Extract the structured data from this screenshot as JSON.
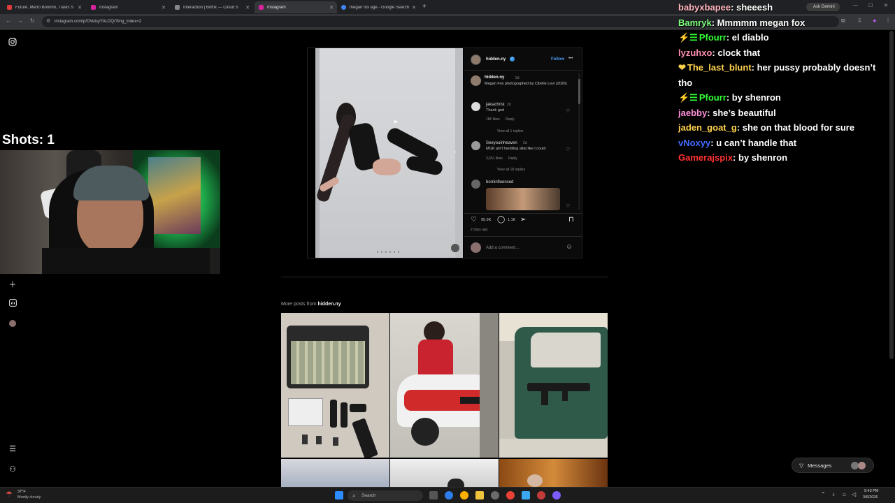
{
  "browser": {
    "tabs": [
      {
        "title": "Future, Metro Boomin, Travis S",
        "active": false,
        "color": "#e03b3b"
      },
      {
        "title": "Instagram",
        "active": false,
        "color": "#d6249f"
      },
      {
        "title": "Interaction | Botfix — Cloud S",
        "active": false,
        "color": "#888888"
      },
      {
        "title": "Instagram",
        "active": true,
        "color": "#d6249f"
      },
      {
        "title": "megan fox age - Google Search",
        "active": false,
        "color": "#4285f4"
      }
    ],
    "new_tab": "+",
    "url": "instagram.com/p/DVetsyYALDQ/?img_index=2",
    "ask_gemini": "Ask Gemini"
  },
  "stream": {
    "shots_label": "Shots: 1"
  },
  "post": {
    "username": "hidden.ny",
    "follow_label": "Follow",
    "more": "•••",
    "caption_user": "hidden.ny",
    "caption_age": "2d",
    "caption_text": "Megan Fox photographed by Cibelle Levi (2026)",
    "comments": [
      {
        "user": "jakiachrist",
        "age": "2d",
        "text": "Thank god",
        "likes": "186 likes",
        "reply": "Reply",
        "view_replies": "View all 1 replies"
      },
      {
        "user": "Seeyouinheaven",
        "age": "2d",
        "text": "MGK ain't handling allat like I could",
        "likes": "3,651 likes",
        "reply": "Reply",
        "view_replies": "View all 18 replies"
      },
      {
        "user": "borninfluenced",
        "age": "",
        "text": "",
        "likes": "",
        "reply": "",
        "view_replies": ""
      }
    ],
    "like_count": "95.9K",
    "comment_count": "1.1K",
    "posted_ago": "2 days ago",
    "add_comment_placeholder": "Add a comment...",
    "more_posts_prefix": "More posts from",
    "more_posts_user": "hidden.ny"
  },
  "chat": [
    {
      "user": "babyxbapee",
      "color": "#ffb6c1",
      "badge": "",
      "text": "sheeesh"
    },
    {
      "user": "Bamryk",
      "color": "#7dff7d",
      "badge": "",
      "text": "Mmmmm megan fox"
    },
    {
      "user": "Pfourr",
      "color": "#33ff33",
      "badge": "⚡☰",
      "text": "el diablo"
    },
    {
      "user": "lyzuhxo",
      "color": "#ff8fb1",
      "badge": "",
      "text": "clock that"
    },
    {
      "user": "The_last_blunt",
      "color": "#ffd24d",
      "badge": "❤",
      "text": "her pussy probably doesn’t tho"
    },
    {
      "user": "Pfourr",
      "color": "#33ff33",
      "badge": "⚡☰",
      "text": "by shenron"
    },
    {
      "user": "jaebby",
      "color": "#ff8fd8",
      "badge": "",
      "text": "she’s beautiful"
    },
    {
      "user": "jaden_goat_g",
      "color": "#ffd24d",
      "badge": "",
      "text": "she on that blood for sure"
    },
    {
      "user": "vNoxyy",
      "color": "#3f6bff",
      "badge": "",
      "text": "u can’t handle that"
    },
    {
      "user": "Gamerajspix",
      "color": "#ff3333",
      "badge": "",
      "text": "by shenron"
    }
  ],
  "messages_label": "Messages",
  "taskbar": {
    "weather_temp": "37°F",
    "weather_desc": "Mostly cloudy",
    "search_placeholder": "Search",
    "time": "9:43 PM",
    "date": "3/6/2026"
  },
  "icons": [
    "instagram-icon",
    "plus-icon",
    "stats-icon",
    "menu-icon",
    "heart-icon",
    "comment-icon",
    "share-icon",
    "bookmark-icon",
    "emoji-icon",
    "verified-icon"
  ]
}
